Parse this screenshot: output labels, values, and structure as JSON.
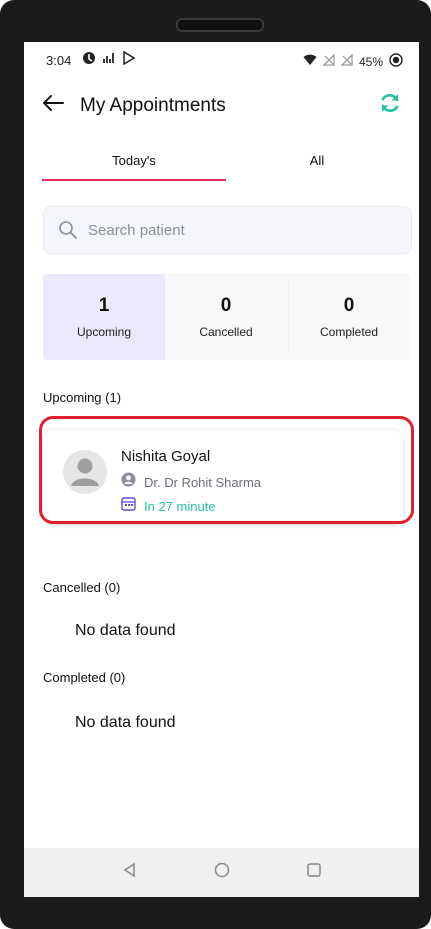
{
  "status_bar": {
    "time": "3:04",
    "battery_percent": "45%",
    "left_icons": [
      "notification-icon",
      "signal-transfer-icon",
      "play-store-icon"
    ],
    "right_icons": [
      "wifi-icon",
      "signal-off-icon",
      "signal-off-icon",
      "battery-icon"
    ]
  },
  "app_bar": {
    "title": "My Appointments",
    "back_icon": "back-arrow-icon",
    "refresh_icon": "refresh-icon",
    "accent_color": "#22c3a2"
  },
  "tabs": [
    {
      "label": "Today's",
      "active": true
    },
    {
      "label": "All",
      "active": false
    }
  ],
  "search": {
    "placeholder": "Search patient"
  },
  "stats": [
    {
      "count": "1",
      "label": "Upcoming",
      "active": true
    },
    {
      "count": "0",
      "label": "Cancelled",
      "active": false
    },
    {
      "count": "0",
      "label": "Completed",
      "active": false
    }
  ],
  "sections": {
    "upcoming": {
      "title": "Upcoming (1)",
      "items": [
        {
          "patient_name": "Nishita Goyal",
          "doctor": "Dr. Dr Rohit Sharma",
          "time": "In 27 minute"
        }
      ]
    },
    "cancelled": {
      "title": "Cancelled (0)",
      "empty_text": "No data found"
    },
    "completed": {
      "title": "Completed (0)",
      "empty_text": "No data found"
    }
  },
  "colors": {
    "tab_indicator": "#e0315e",
    "time_text": "#22c3a2",
    "highlight": "#e0212b",
    "active_stat_bg": "#ece8fb"
  }
}
